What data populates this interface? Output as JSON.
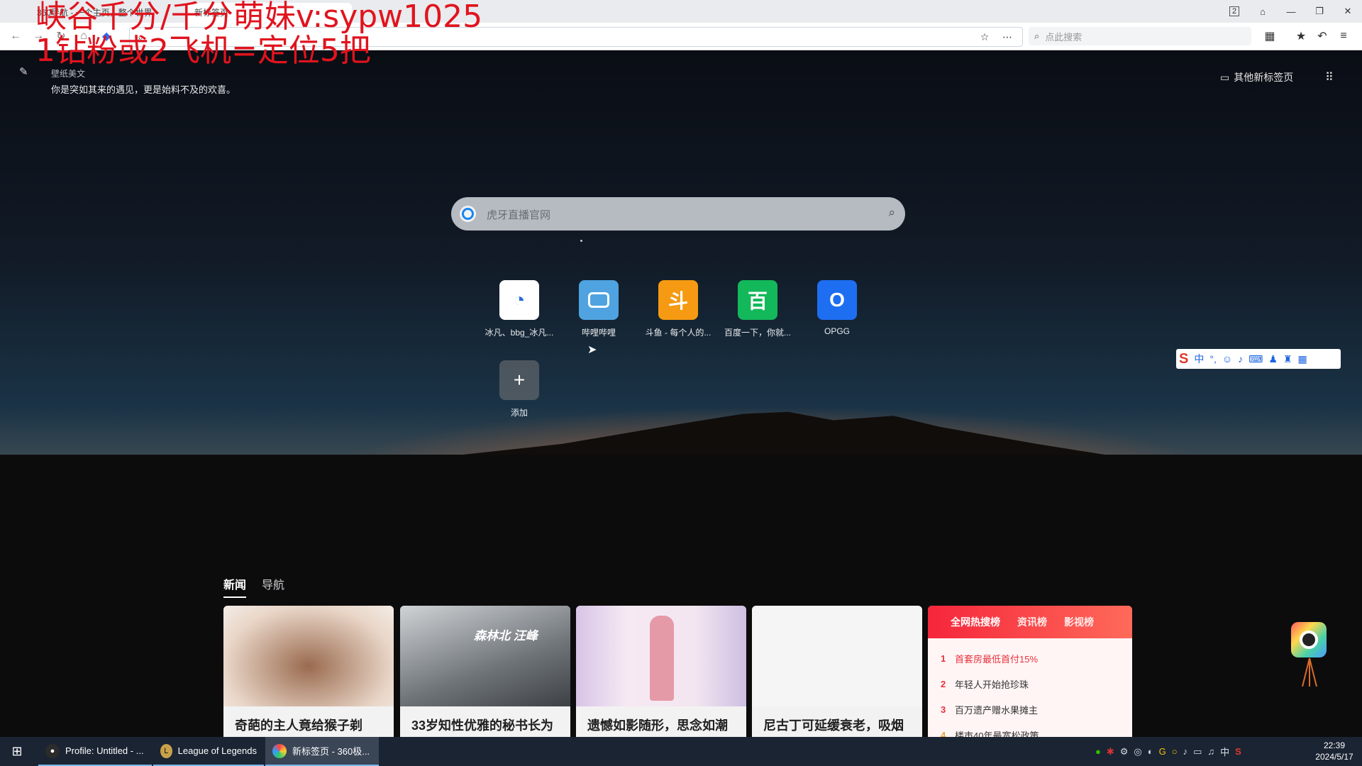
{
  "overlay": {
    "line1": "峡谷千分/千分萌妹v:sypw1025",
    "line2": "1钻粉或2飞机=定位5把"
  },
  "browser": {
    "tabs": [
      {
        "label": "360导航 - 一个主页，整个世界",
        "active": false
      },
      {
        "label": "新标签页",
        "active": true
      }
    ],
    "tab_count_badge": "2",
    "search_placeholder": "点此搜索"
  },
  "page": {
    "wallpaper_title": "壁纸美文",
    "wallpaper_quote": "你是突如其来的遇见，更是始料不及的欢喜。",
    "other_newtab_label": "其他新标签页",
    "search_placeholder": "虎牙直播官网",
    "shortcuts": [
      {
        "label": "冰凡、bbg_冰凡...",
        "icon": "bbg-icon",
        "color": "#ffffff"
      },
      {
        "label": "哔哩哔哩",
        "icon": "bilibili-icon",
        "color": "#4fa3e0"
      },
      {
        "label": "斗鱼 - 每个人的...",
        "icon": "douyu-icon",
        "color": "#f59a12",
        "glyph": "斗"
      },
      {
        "label": "百度一下，你就...",
        "icon": "baidu-icon",
        "color": "#13b85a",
        "glyph": "百"
      },
      {
        "label": "OPGG",
        "icon": "opgg-icon",
        "color": "#1e6ef2",
        "glyph": "O"
      }
    ],
    "add_label": "添加",
    "add_glyph": "+"
  },
  "ime": {
    "mode": "中"
  },
  "news": {
    "tabs": [
      {
        "label": "新闻",
        "active": true
      },
      {
        "label": "导航",
        "active": false
      }
    ],
    "cards": [
      {
        "title": "奇葩的主人竟给猴子剃"
      },
      {
        "title": "33岁知性优雅的秘书长为",
        "overlay_text": "森林北 汪峰"
      },
      {
        "title": "遗憾如影随形，思念如潮"
      },
      {
        "title": "尼古丁可延缓衰老，吸烟"
      }
    ],
    "hot": {
      "tabs": [
        {
          "label": "全网热搜榜",
          "active": true
        },
        {
          "label": "资讯榜",
          "active": false
        },
        {
          "label": "影视榜",
          "active": false
        }
      ],
      "items": [
        {
          "rank": "1",
          "text": "首套房最低首付15%"
        },
        {
          "rank": "2",
          "text": "年轻人开始抢珍珠"
        },
        {
          "rank": "3",
          "text": "百万遗产赠水果摊主"
        },
        {
          "rank": "4",
          "text": "楼市40年最宽松政策"
        }
      ]
    }
  },
  "taskbar": {
    "items": [
      {
        "label": "Profile: Untitled - ...",
        "icon": "obs-icon"
      },
      {
        "label": "League of Legends",
        "icon": "league-icon"
      },
      {
        "label": "新标签页 - 360极...",
        "icon": "browser-360-icon",
        "active": true
      }
    ],
    "ime_indicator": "中",
    "time": "22:39",
    "date": "2024/5/17"
  }
}
